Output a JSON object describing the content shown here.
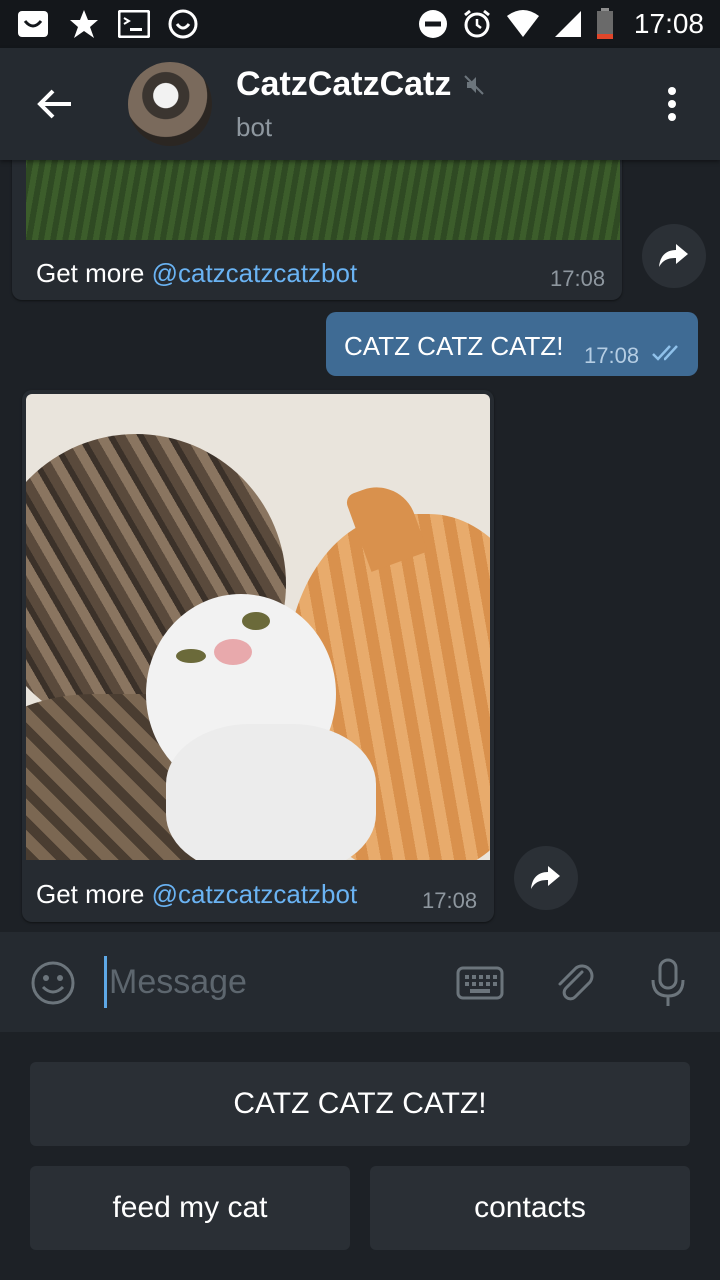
{
  "status_bar": {
    "time": "17:08"
  },
  "header": {
    "title": "CatzCatzCatz",
    "subtitle": "bot"
  },
  "messages": [
    {
      "caption_prefix": "Get more ",
      "caption_link": "@catzcatzcatzbot",
      "time": "17:08"
    },
    {
      "text": "CATZ CATZ CATZ!",
      "time": "17:08"
    },
    {
      "caption_prefix": "Get more ",
      "caption_link": "@catzcatzcatzbot",
      "time": "17:08"
    }
  ],
  "input": {
    "placeholder": "Message"
  },
  "keyboard": {
    "row1": "CATZ CATZ CATZ!",
    "row2_left": "feed my cat",
    "row2_right": "contacts"
  },
  "colors": {
    "background": "#1d2126",
    "header": "#252a30",
    "incoming_bubble": "#262b31",
    "outgoing_bubble": "#3f6b94",
    "link": "#6ab3f3",
    "battery_low": "#e0462a"
  }
}
